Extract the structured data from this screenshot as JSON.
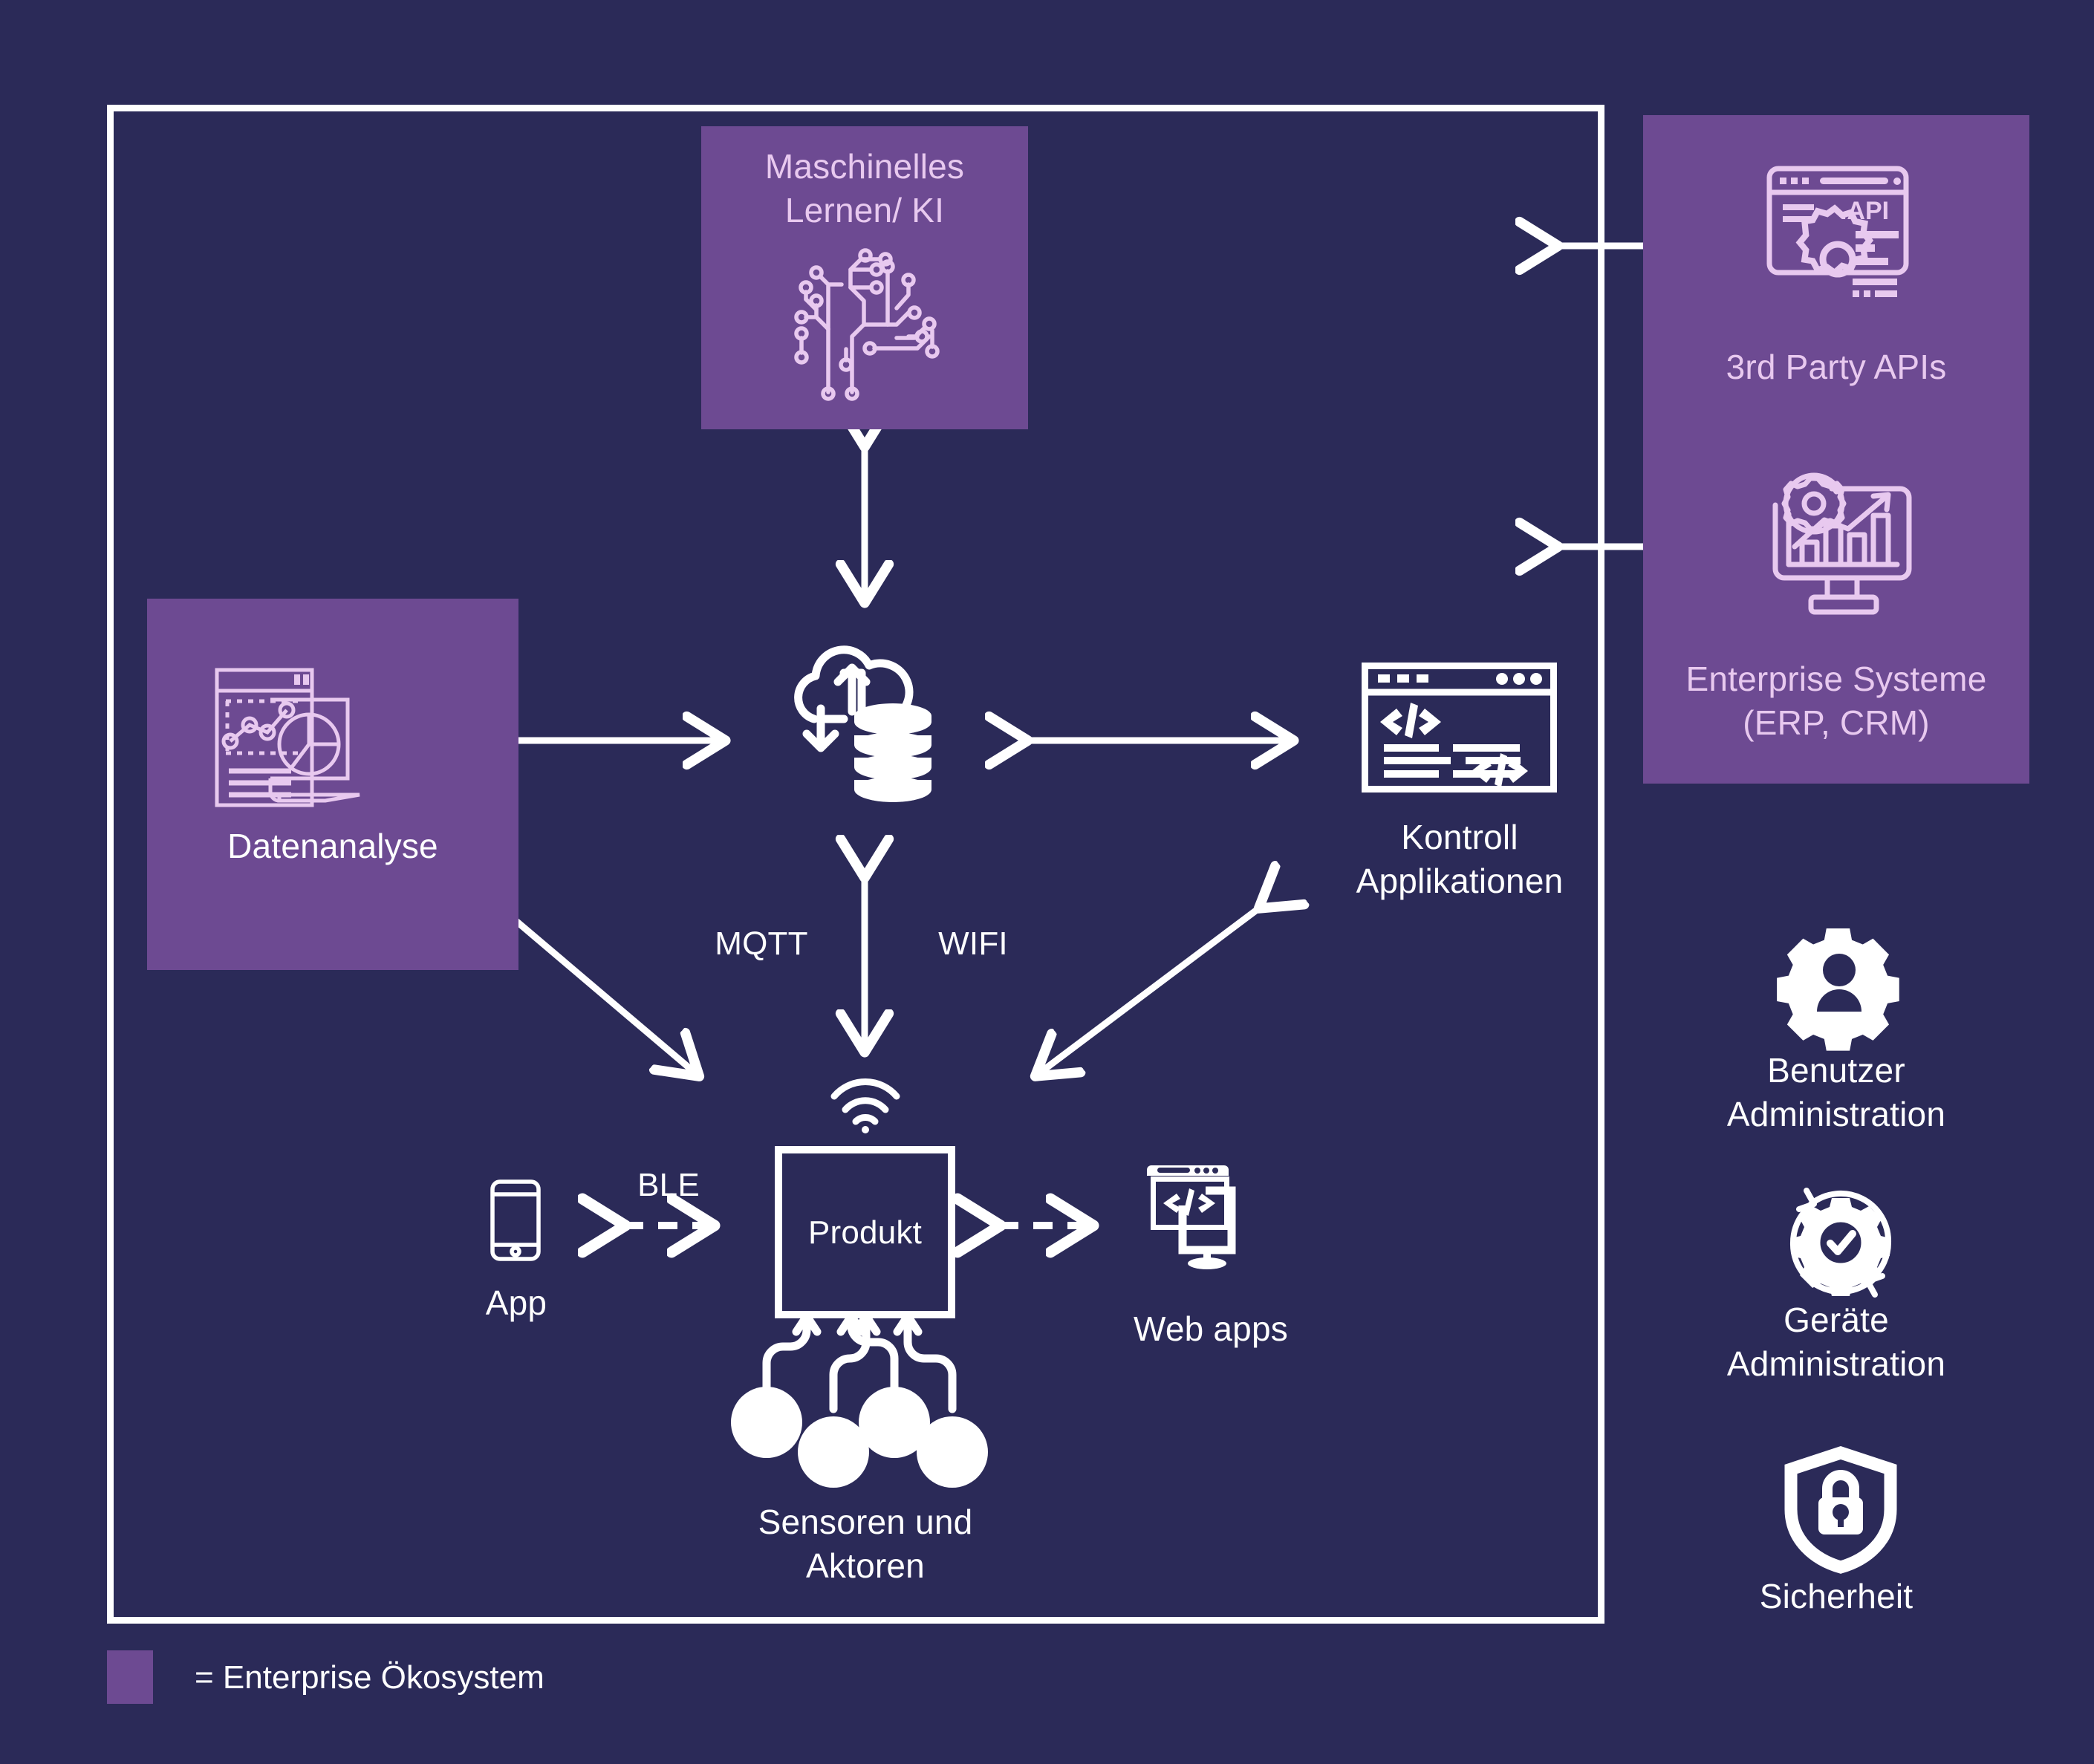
{
  "colors": {
    "background": "#2b2a58",
    "purple_panel": "#6d4a92",
    "white": "#ffffff",
    "lilac": "#e8c9ef"
  },
  "frame": {
    "name": "main system boundary"
  },
  "nodes": {
    "machine_learning": {
      "label": "Maschinelles\nLernen/ KI",
      "icon": "circuit-brain-icon",
      "highlight": "enterprise"
    },
    "data_analytics": {
      "label": "Datenanalyse",
      "icon": "data-analytics-dashboard-icon",
      "highlight": "enterprise"
    },
    "cloud_storage": {
      "label": "",
      "icon": "cloud-database-icon",
      "highlight": "none"
    },
    "control_apps": {
      "label": "Kontroll\nApplikationen",
      "icon": "code-window-icon",
      "highlight": "none"
    },
    "product": {
      "label": "Produkt",
      "icon": "wifi-signal-icon",
      "highlight": "none"
    },
    "sensors": {
      "label": "Sensoren und\nAktoren",
      "icon": "sensor-nodes-icon",
      "highlight": "none"
    },
    "app": {
      "label": "App",
      "icon": "smartphone-icon",
      "highlight": "none"
    },
    "web_apps": {
      "label": "Web apps",
      "icon": "monitor-code-icon",
      "highlight": "none"
    }
  },
  "enterprise_panel": {
    "items": [
      {
        "label": "3rd Party APIs",
        "icon": "api-window-gear-icon"
      },
      {
        "label": "Enterprise Systeme\n(ERP, CRM)",
        "icon": "monitor-chart-gear-icon"
      }
    ]
  },
  "side_services": [
    {
      "label": "Benutzer\nAdministration",
      "icon": "user-gear-icon"
    },
    {
      "label": "Geräte\nAdministration",
      "icon": "gear-check-cycle-icon"
    },
    {
      "label": "Sicherheit",
      "icon": "shield-lock-icon"
    }
  ],
  "connection_labels": {
    "mqtt": "MQTT",
    "wifi": "WIFI",
    "ble": "BLE"
  },
  "legend": {
    "text": "= Enterprise Ökosystem",
    "swatch_color": "#6d4a92"
  }
}
